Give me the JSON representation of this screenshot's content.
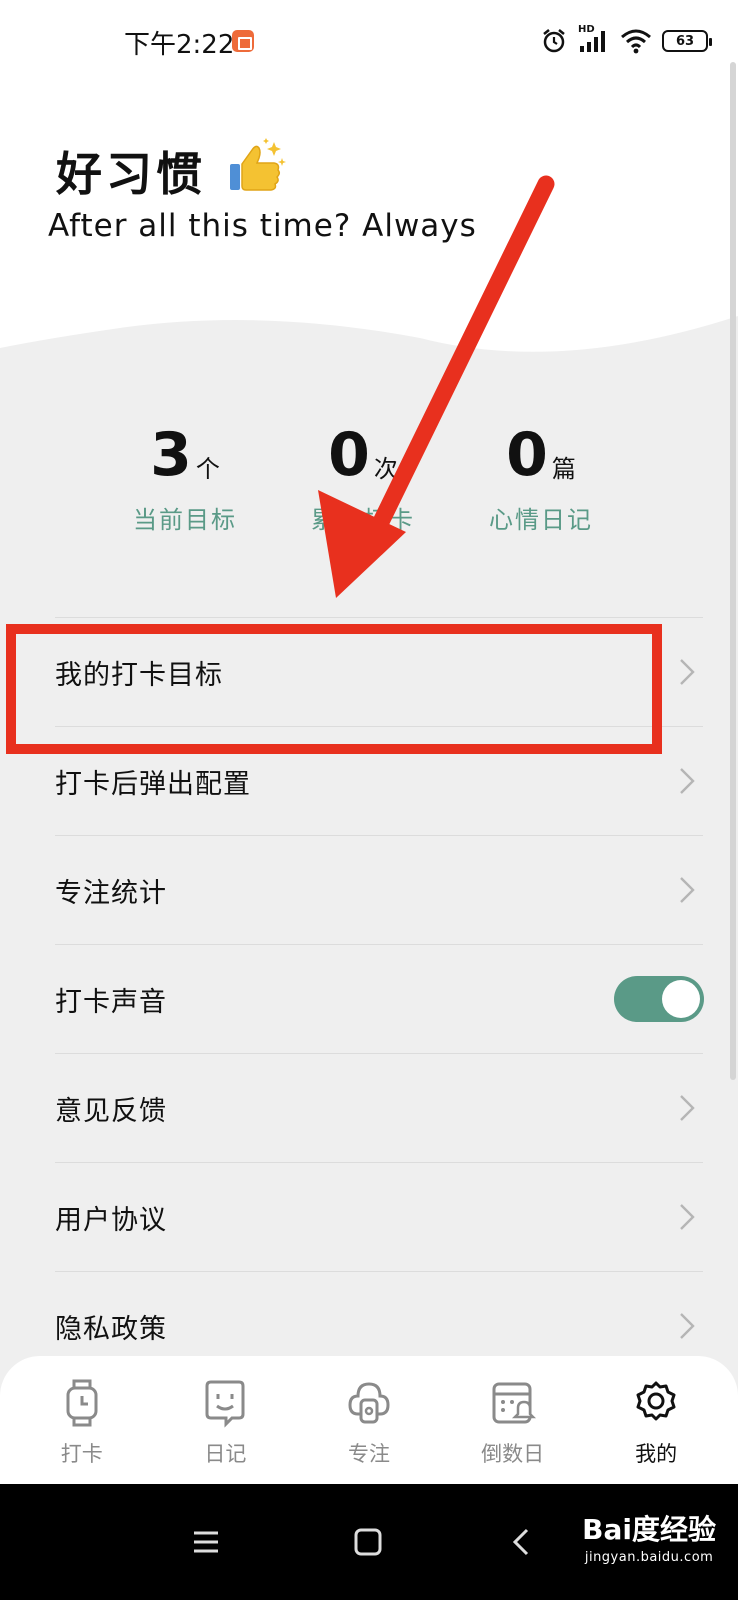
{
  "status_bar": {
    "time": "下午2:22",
    "network_type": "HD",
    "battery_level": "63"
  },
  "header": {
    "title": "好习惯",
    "slogan": "After all this time? Always"
  },
  "stats": [
    {
      "value": "3",
      "unit": "个",
      "label": "当前目标"
    },
    {
      "value": "0",
      "unit": "次",
      "label": "累计打卡"
    },
    {
      "value": "0",
      "unit": "篇",
      "label": "心情日记"
    }
  ],
  "settings": [
    {
      "label": "我的打卡目标",
      "control": "chevron"
    },
    {
      "label": "打卡后弹出配置",
      "control": "chevron"
    },
    {
      "label": "专注统计",
      "control": "chevron"
    },
    {
      "label": "打卡声音",
      "control": "toggle",
      "toggle_on": true
    },
    {
      "label": "意见反馈",
      "control": "chevron"
    },
    {
      "label": "用户协议",
      "control": "chevron"
    },
    {
      "label": "隐私政策",
      "control": "chevron"
    }
  ],
  "tabs": [
    {
      "label": "打卡",
      "icon": "watch-icon",
      "active": false
    },
    {
      "label": "日记",
      "icon": "diary-face-icon",
      "active": false
    },
    {
      "label": "专注",
      "icon": "focus-timer-icon",
      "active": false
    },
    {
      "label": "倒数日",
      "icon": "countdown-calendar-icon",
      "active": false
    },
    {
      "label": "我的",
      "icon": "gear-icon",
      "active": true
    }
  ],
  "watermark": {
    "brand": "Bai度经验",
    "url": "jingyan.baidu.com"
  },
  "colors": {
    "accent": "#5a9a87",
    "annotation": "#e8301e",
    "background": "#efefef"
  }
}
